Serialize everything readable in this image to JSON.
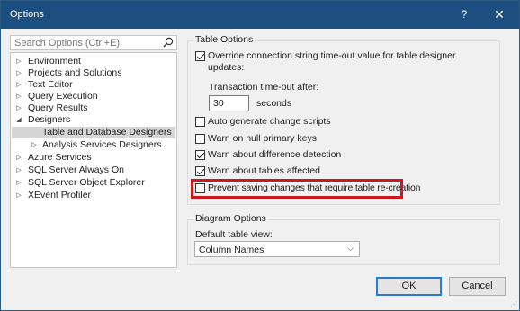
{
  "window": {
    "title": "Options",
    "help_glyph": "?",
    "close_glyph": "✕"
  },
  "search": {
    "placeholder": "Search Options (Ctrl+E)"
  },
  "tree": {
    "items": [
      {
        "label": "Environment",
        "arrow": "▷"
      },
      {
        "label": "Projects and Solutions",
        "arrow": "▷"
      },
      {
        "label": "Text Editor",
        "arrow": "▷"
      },
      {
        "label": "Query Execution",
        "arrow": "▷"
      },
      {
        "label": "Query Results",
        "arrow": "▷"
      },
      {
        "label": "Designers",
        "arrow": "◢"
      },
      {
        "label": "Table and Database Designers",
        "arrow": ""
      },
      {
        "label": "Analysis Services Designers",
        "arrow": "▷"
      },
      {
        "label": "Azure Services",
        "arrow": "▷"
      },
      {
        "label": "SQL Server Always On",
        "arrow": "▷"
      },
      {
        "label": "SQL Server Object Explorer",
        "arrow": "▷"
      },
      {
        "label": "XEvent Profiler",
        "arrow": "▷"
      }
    ],
    "selected": "Table and Database Designers"
  },
  "table_options": {
    "group_label": "Table Options",
    "override_timeout": {
      "label_line1": "Override connection string time-out value for table designer",
      "label_line2": "updates:",
      "checked": true
    },
    "transaction_timeout": {
      "label": "Transaction time-out after:",
      "value": "30",
      "unit": "seconds"
    },
    "auto_generate": {
      "label": "Auto generate change scripts",
      "checked": false
    },
    "warn_null_keys": {
      "label": "Warn on null primary keys",
      "checked": false
    },
    "warn_difference": {
      "label": "Warn about difference detection",
      "checked": true
    },
    "warn_tables": {
      "label": "Warn about tables affected",
      "checked": true
    },
    "prevent_saving": {
      "label": "Prevent saving changes that require table re-creation",
      "checked": false
    }
  },
  "diagram_options": {
    "group_label": "Diagram Options",
    "default_view_label": "Default table view:",
    "default_view_value": "Column Names"
  },
  "footer": {
    "ok_label": "OK",
    "cancel_label": "Cancel"
  },
  "colors": {
    "titlebar": "#1c4f80",
    "highlight": "#d0161d",
    "default_button_border": "#2a7ad4"
  }
}
